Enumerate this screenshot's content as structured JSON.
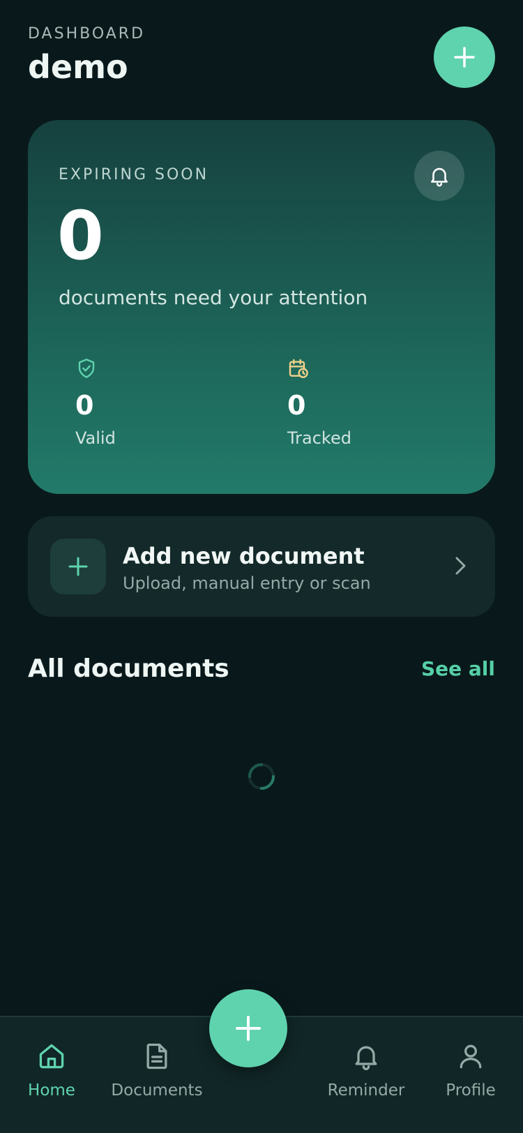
{
  "header": {
    "eyebrow": "DASHBOARD",
    "title": "demo"
  },
  "summary_card": {
    "eyebrow": "EXPIRING SOON",
    "count": "0",
    "subtitle": "documents need your attention",
    "stats": [
      {
        "value": "0",
        "label": "Valid",
        "icon": "shield-check-icon"
      },
      {
        "value": "0",
        "label": "Tracked",
        "icon": "calendar-clock-icon"
      }
    ]
  },
  "add_card": {
    "title": "Add new document",
    "subtitle": "Upload, manual entry or scan"
  },
  "section": {
    "title": "All documents",
    "action": "See all"
  },
  "tabs": [
    {
      "label": "Home",
      "icon": "home-icon",
      "active": true
    },
    {
      "label": "Documents",
      "icon": "document-icon",
      "active": false
    },
    {
      "label": "Reminder",
      "icon": "bell-icon",
      "active": false
    },
    {
      "label": "Profile",
      "icon": "user-icon",
      "active": false
    }
  ],
  "colors": {
    "accent": "#5fd3ae",
    "background": "#09191b",
    "card_top": "#16413f",
    "card_bottom": "#227a6a",
    "tracked_icon": "#f0d28a"
  }
}
